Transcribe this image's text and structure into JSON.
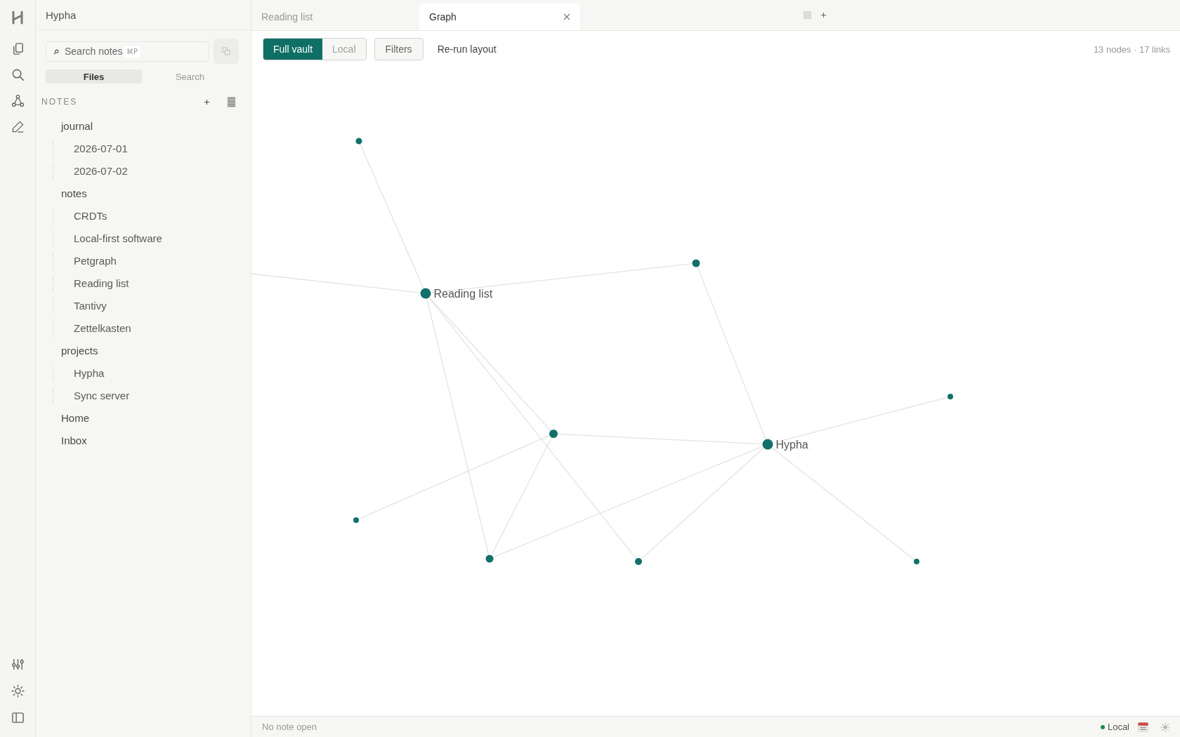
{
  "app": {
    "title": "Hypha"
  },
  "search": {
    "placeholder": "Search notes",
    "shortcut": "⌘P"
  },
  "sidebar_tabs": [
    {
      "label": "Files",
      "selected": true
    },
    {
      "label": "Search",
      "selected": false
    }
  ],
  "notes": {
    "heading": "NOTES",
    "tree": [
      {
        "label": "journal",
        "children": [
          {
            "label": "2026-07-01"
          },
          {
            "label": "2026-07-02"
          }
        ]
      },
      {
        "label": "notes",
        "children": [
          {
            "label": "CRDTs"
          },
          {
            "label": "Local-first software"
          },
          {
            "label": "Petgraph"
          },
          {
            "label": "Reading list"
          },
          {
            "label": "Tantivy"
          },
          {
            "label": "Zettelkasten"
          }
        ]
      },
      {
        "label": "projects",
        "children": [
          {
            "label": "Hypha"
          },
          {
            "label": "Sync server"
          }
        ]
      },
      {
        "label": "Home"
      },
      {
        "label": "Inbox"
      }
    ]
  },
  "tabs": [
    {
      "label": "Reading list",
      "selected": false
    },
    {
      "label": "Graph",
      "selected": true
    }
  ],
  "graph_toolbar": {
    "scope": [
      {
        "label": "Full vault",
        "selected": true
      },
      {
        "label": "Local",
        "selected": false
      }
    ],
    "filters": "Filters",
    "rerun": "Re-run layout",
    "stats": "13 nodes · 17 links"
  },
  "graph": {
    "node_labels": [
      "Reading list",
      "Hypha"
    ]
  },
  "status_bar": {
    "message": "No note open",
    "sync": "Local"
  }
}
